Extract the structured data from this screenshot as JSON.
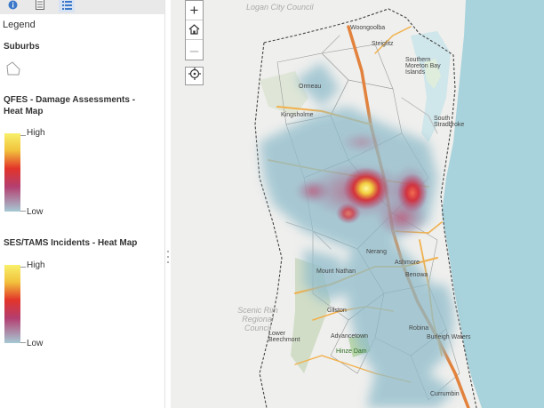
{
  "toolbar": {
    "buttons": [
      {
        "icon": "info-icon",
        "active": false
      },
      {
        "icon": "layer-list-icon",
        "active": false
      },
      {
        "icon": "legend-icon",
        "active": true
      }
    ]
  },
  "legend": {
    "title": "Legend",
    "layers": [
      {
        "title": "Suburbs",
        "symbol": "polygon-outline"
      },
      {
        "title": "QFES - Damage Assessments - Heat Map",
        "high": "High",
        "low": "Low"
      },
      {
        "title": "SES/TAMS Incidents - Heat Map",
        "high": "High",
        "low": "Low"
      }
    ]
  },
  "map": {
    "controls": {
      "zoom_in": "+",
      "zoom_out": "–"
    },
    "labels": {
      "logan": "Logan City Council",
      "scenic_rim": "Scenic Rim Regional Council",
      "woongoolba": "Woongoolba",
      "steiglitz": "Steiglitz",
      "southern_moreton": "Southern Moreton Bay Islands",
      "south_stradbroke": "South Stradbroke",
      "ormeau": "Ormeau",
      "kingsholme": "Kingsholme",
      "nerang": "Nerang",
      "ashmore": "Ashmore",
      "benowa": "Benowa",
      "mount_nathan": "Mount Nathan",
      "gilston": "Gilston",
      "advancetown": "Advancetown",
      "hinze_dam": "Hinze Dam",
      "lower_beechmont": "Lower Beechmont",
      "robina": "Robina",
      "burleigh": "Burleigh Waters",
      "currumbin": "Currumbin"
    },
    "colors": {
      "land": "#efefed",
      "ocean": "#a9d3dc",
      "road_major": "#f2b04b",
      "road_highway": "#e2823c",
      "heat_low": "#8fbccb",
      "heat_mid": "#c0345c",
      "heat_high": "#f8ee4a"
    }
  }
}
